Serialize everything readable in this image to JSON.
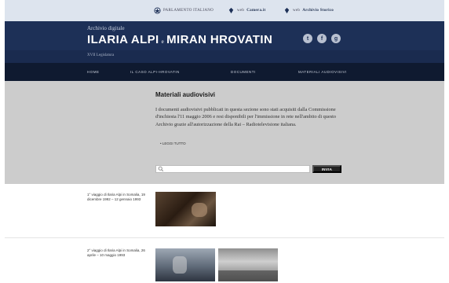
{
  "topbar": {
    "links": [
      {
        "label": "PARLAMENTO ITALIANO"
      },
      {
        "prefix": "web",
        "label": "Camera.it"
      },
      {
        "prefix": "web",
        "label": "Archivio Storico"
      }
    ]
  },
  "header": {
    "pre_title": "Archivio digitale",
    "title_left": "ILARIA ALPI",
    "title_amp": "e",
    "title_right": "MIRAN HROVATIN",
    "legislature": "XVII Legislatura",
    "social": [
      "t",
      "f",
      "g"
    ]
  },
  "nav": {
    "items": [
      "HOME",
      "IL CASO ALPI-HROVATIN",
      "DOCUMENTI",
      "MATERIALI AUDIOVISIVI"
    ]
  },
  "main": {
    "heading": "Materiali audiovisivi",
    "intro": "I documenti audiovisivi pubblicati in questa sezione sono stati acquisiti dalla Commissione d'inchiesta l'11 maggio 2006 e resi disponibili per l'immissione in rete nell'ambito di questo Archivio grazie all'autorizzazione della Rai – Radiotelevisione italiana.",
    "more_link": "• LEGGI TUTTO",
    "search": {
      "placeholder": "",
      "value": ""
    },
    "search_button": "INVIA"
  },
  "rows": [
    {
      "caption": "1° viaggio di Ilaria Alpi in Somalia, 19 dicembre 1992 – 12 gennaio 1993"
    },
    {
      "caption": "2° viaggio di Ilaria Alpi in Somalia, 26 aprile – 10 maggio 1993"
    }
  ]
}
